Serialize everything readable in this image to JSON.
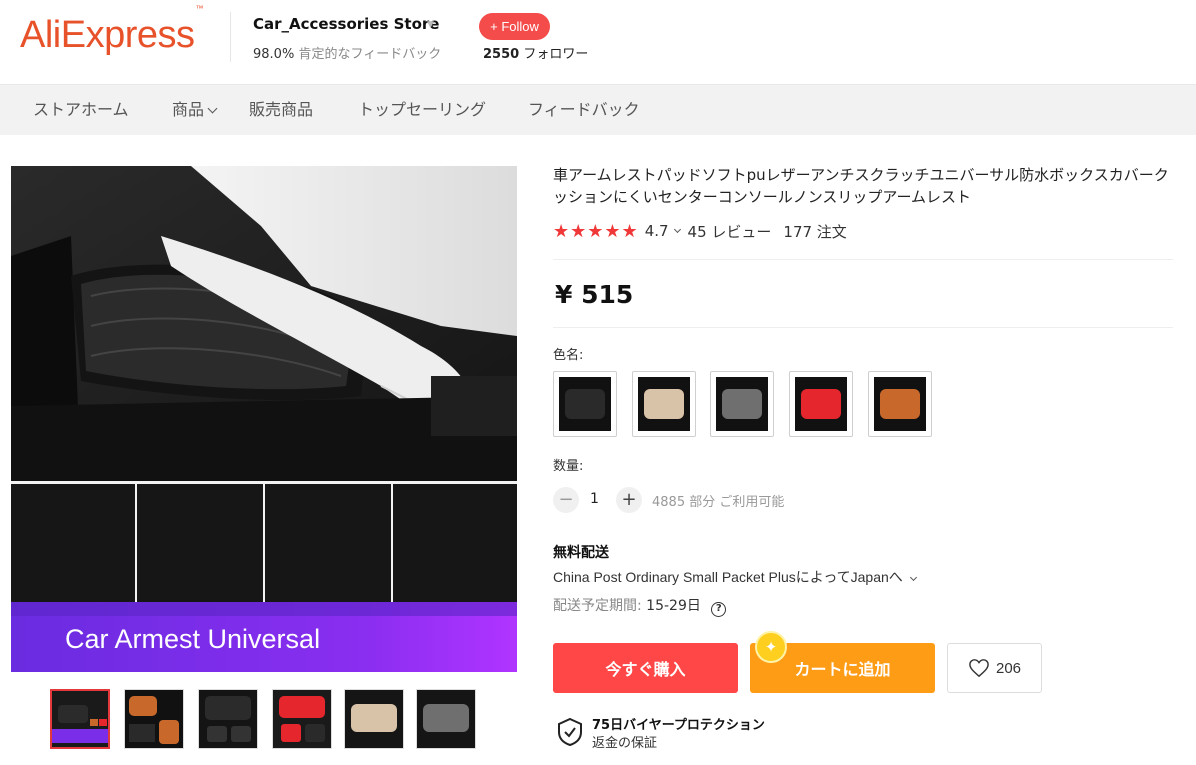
{
  "header": {
    "logo": "AliExpress",
    "logo_tm": "™",
    "store_name": "Car_Accessories Store",
    "positive_pct": "98.0%",
    "positive_label": "肯定的なフィードバック",
    "follow_label": "+ Follow",
    "followers_count": "2550",
    "followers_label": "フォロワー"
  },
  "nav": {
    "items": [
      "ストアホーム",
      "商品",
      "販売商品",
      "トップセーリング",
      "フィードバック"
    ]
  },
  "gallery": {
    "banner_text": "Car Armest Universal",
    "thumbnail_count": 6
  },
  "product": {
    "title": "車アームレストパッドソフトpuレザーアンチスクラッチユニバーサル防水ボックスカバークッションにくいセンターコンソールノンスリップアームレスト",
    "stars": "★★★★★",
    "rating": "4.7",
    "reviews": "45 レビュー",
    "orders": "177 注文",
    "price": "¥ 515",
    "color_label": "色名:",
    "swatches": [
      {
        "name": "black",
        "color": "#2a2a2a"
      },
      {
        "name": "beige",
        "color": "#d8c3a8"
      },
      {
        "name": "gray",
        "color": "#6f6f6f"
      },
      {
        "name": "red",
        "color": "#e5262c"
      },
      {
        "name": "brown",
        "color": "#c8692b"
      }
    ],
    "quantity_label": "数量:",
    "quantity_minus": "−",
    "quantity_value": "1",
    "quantity_plus": "+",
    "stock": "4885 部分 ご利用可能"
  },
  "shipping": {
    "title": "無料配送",
    "method": "China Post Ordinary Small Packet PlusによってJapanへ",
    "eta_label": "配送予定期間:",
    "eta_value": "15-29日",
    "help_icon": "?"
  },
  "actions": {
    "buy_now": "今すぐ購入",
    "add_to_cart": "カートに追加",
    "wishlist_count": "206"
  },
  "protection": {
    "title": "75日バイヤープロテクション",
    "subtitle": "返金の保証"
  },
  "colors": {
    "brand": "#e8522a",
    "follow": "#f44b4b",
    "buy": "#ff4747",
    "cart": "#ff9c16",
    "stars": "#f03838"
  }
}
